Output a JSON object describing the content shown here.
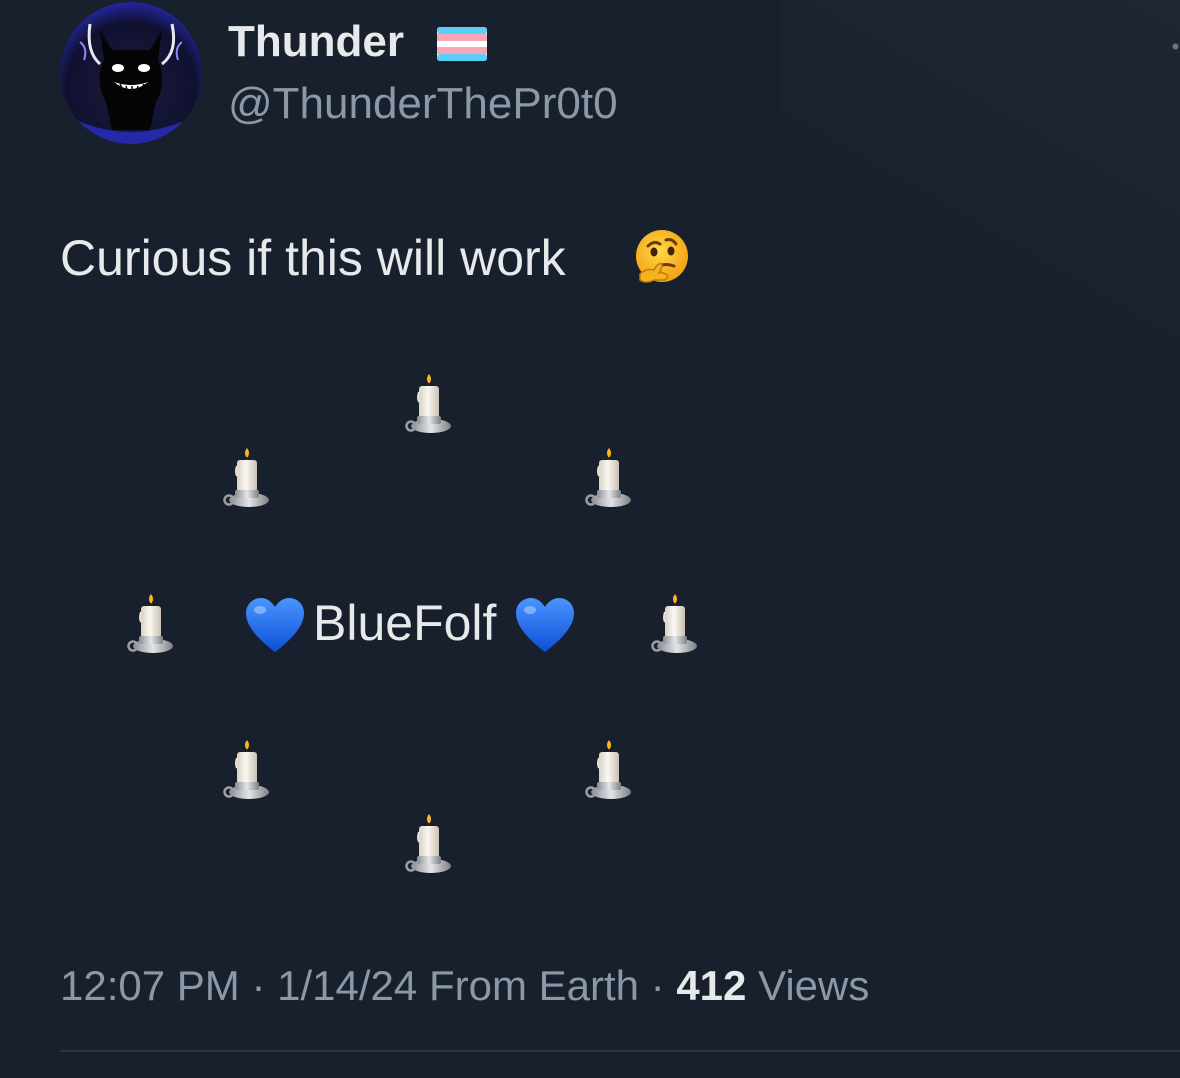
{
  "author": {
    "display_name": "Thunder",
    "handle": "@ThunderThePr0t0",
    "flag_icon": "transgender-flag-icon",
    "flag_colors": [
      "#5bcefa",
      "#f5a9b8",
      "#ffffff"
    ]
  },
  "tweet": {
    "text": "Curious if this will work",
    "text_emoji": "thinking-face-icon",
    "center_label": "BlueFolf",
    "center_emoji": "blue-heart-icon",
    "ring_emoji": "candle-icon",
    "ring_candle_count": 8
  },
  "meta": {
    "time": "12:07 PM",
    "separator": "·",
    "date": "1/14/24",
    "location": "From Earth",
    "views_count": "412",
    "views_label": "Views"
  },
  "colors": {
    "background": "#17202c",
    "text_primary": "#e7e9ea",
    "text_secondary": "#8b98a5",
    "heart_blue": "#1d6ff2",
    "avatar_accent": "#2a2fc4"
  }
}
